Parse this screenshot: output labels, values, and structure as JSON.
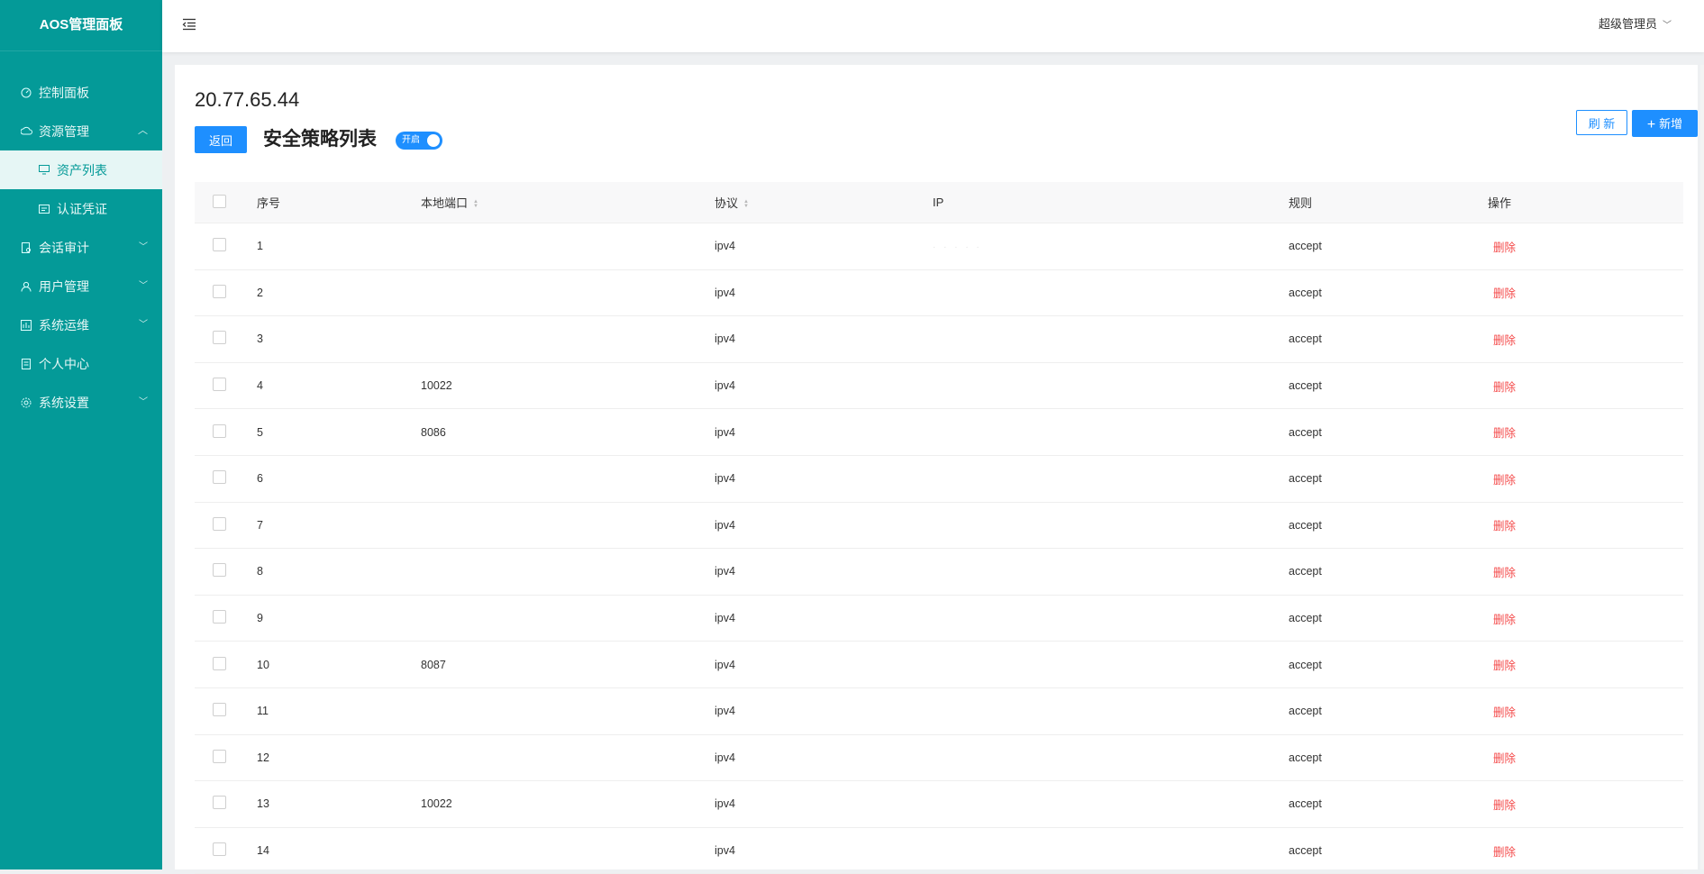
{
  "app": {
    "title": "AOS管理面板"
  },
  "sidebar": {
    "items": [
      {
        "label": "控制面板",
        "icon": "dashboard-icon"
      },
      {
        "label": "资源管理",
        "icon": "cloud-icon",
        "arrow": "^"
      },
      {
        "label": "资产列表",
        "icon": "monitor-icon"
      },
      {
        "label": "认证凭证",
        "icon": "id-card-icon"
      },
      {
        "label": "会话审计",
        "icon": "audit-icon",
        "arrow": "v"
      },
      {
        "label": "用户管理",
        "icon": "user-icon",
        "arrow": "v"
      },
      {
        "label": "系统运维",
        "icon": "ops-icon",
        "arrow": "v"
      },
      {
        "label": "个人中心",
        "icon": "profile-icon"
      },
      {
        "label": "系统设置",
        "icon": "settings-icon",
        "arrow": "v"
      }
    ]
  },
  "header": {
    "user": "超级管理员"
  },
  "page": {
    "ip": "20.77.65.44",
    "back_label": "返回",
    "title": "安全策略列表",
    "switch_label": "开启",
    "refresh_label": "刷 新",
    "add_label": "新增"
  },
  "table": {
    "columns": [
      "序号",
      "本地端口",
      "协议",
      "IP",
      "规则",
      "操作"
    ],
    "ip_placeholder": "· · · · ·",
    "rows": [
      {
        "no": "1",
        "port": "",
        "proto": "ipv4",
        "rule": "accept",
        "op": "删除"
      },
      {
        "no": "2",
        "port": "",
        "proto": "ipv4",
        "rule": "accept",
        "op": "删除"
      },
      {
        "no": "3",
        "port": "",
        "proto": "ipv4",
        "rule": "accept",
        "op": "删除"
      },
      {
        "no": "4",
        "port": "10022",
        "proto": "ipv4",
        "rule": "accept",
        "op": "删除"
      },
      {
        "no": "5",
        "port": "8086",
        "proto": "ipv4",
        "rule": "accept",
        "op": "删除"
      },
      {
        "no": "6",
        "port": "",
        "proto": "ipv4",
        "rule": "accept",
        "op": "删除"
      },
      {
        "no": "7",
        "port": "",
        "proto": "ipv4",
        "rule": "accept",
        "op": "删除"
      },
      {
        "no": "8",
        "port": "",
        "proto": "ipv4",
        "rule": "accept",
        "op": "删除"
      },
      {
        "no": "9",
        "port": "",
        "proto": "ipv4",
        "rule": "accept",
        "op": "删除"
      },
      {
        "no": "10",
        "port": "8087",
        "proto": "ipv4",
        "rule": "accept",
        "op": "删除"
      },
      {
        "no": "11",
        "port": "",
        "proto": "ipv4",
        "rule": "accept",
        "op": "删除"
      },
      {
        "no": "12",
        "port": "",
        "proto": "ipv4",
        "rule": "accept",
        "op": "删除"
      },
      {
        "no": "13",
        "port": "10022",
        "proto": "ipv4",
        "rule": "accept",
        "op": "删除"
      },
      {
        "no": "14",
        "port": "",
        "proto": "ipv4",
        "rule": "accept",
        "op": "删除"
      }
    ]
  },
  "colors": {
    "sidebar": "#049a98",
    "primary": "#1e8fff",
    "danger": "#f44a4a"
  }
}
